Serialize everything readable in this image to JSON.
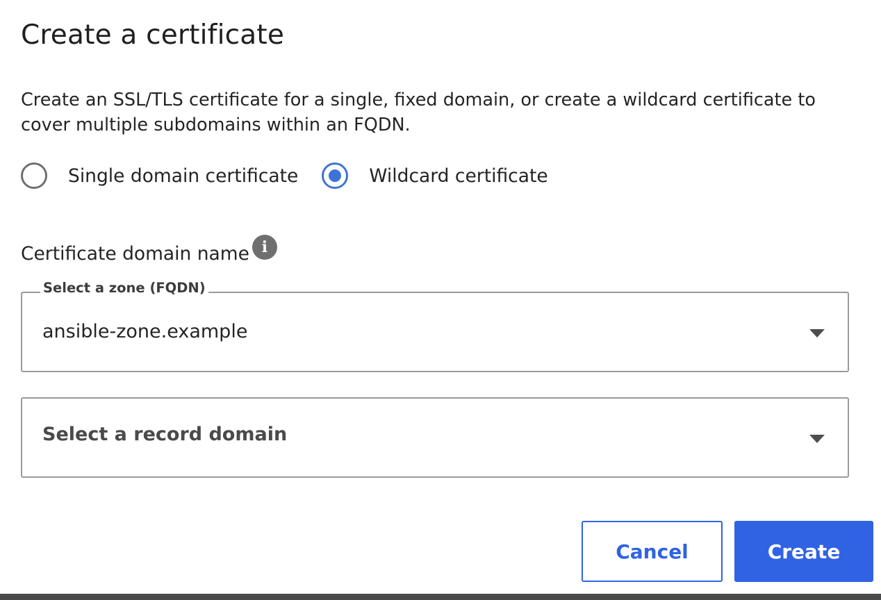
{
  "dialog": {
    "title": "Create a certificate",
    "description": "Create an SSL/TLS certificate for a single, fixed domain, or create a wildcard certificate to cover multiple subdomains within an FQDN."
  },
  "certificate_type": {
    "options": [
      {
        "label": "Single domain certificate",
        "selected": false
      },
      {
        "label": "Wildcard certificate",
        "selected": true
      }
    ]
  },
  "domain_field": {
    "label": "Certificate domain name",
    "info_icon": "info-icon",
    "zone_select": {
      "legend": "Select a zone (FQDN)",
      "value": "ansible-zone.example"
    },
    "record_select": {
      "placeholder": "Select a record domain"
    }
  },
  "actions": {
    "cancel_label": "Cancel",
    "create_label": "Create"
  },
  "colors": {
    "primary": "#2f63e3",
    "radio_selected": "#3d72d7",
    "border": "#9a9a9a"
  }
}
